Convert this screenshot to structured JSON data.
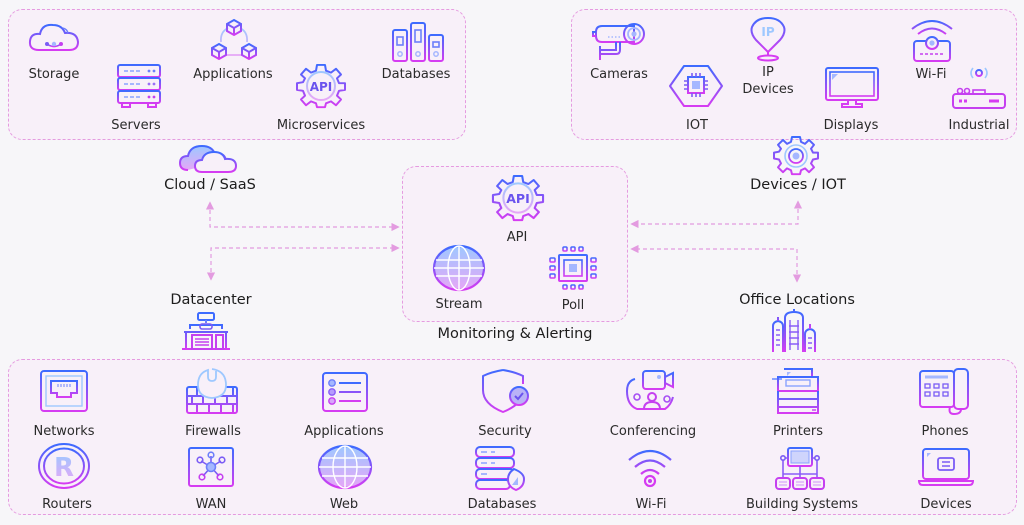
{
  "colors": {
    "gradient_top": "#3d6bff",
    "gradient_bottom": "#d63cf2",
    "accent_light": "#a5b7ff",
    "connector": "#e39be0",
    "box_border": "#e59be0",
    "box_fill": "#f8f0f9",
    "background": "#f7f6f9"
  },
  "cloud_group": {
    "items": [
      {
        "label": "Storage",
        "icon": "cloud-storage-icon"
      },
      {
        "label": "Servers",
        "icon": "server-rack-icon"
      },
      {
        "label": "Applications",
        "icon": "cubes-network-icon"
      },
      {
        "label": "Microservices",
        "icon": "api-gear-icon"
      },
      {
        "label": "Databases",
        "icon": "database-stack-icon"
      }
    ]
  },
  "devices_group": {
    "items": [
      {
        "label": "Cameras",
        "icon": "security-camera-icon"
      },
      {
        "label": "IOT",
        "icon": "chip-hexagon-icon"
      },
      {
        "label": "IP\nDevices",
        "label_line1": "IP",
        "label_line2": "Devices",
        "icon": "ip-pin-icon"
      },
      {
        "label": "Displays",
        "icon": "monitor-icon"
      },
      {
        "label": "Wi-Fi",
        "icon": "wifi-projector-icon"
      },
      {
        "label": "Industrial",
        "icon": "industrial-router-icon"
      }
    ]
  },
  "hubs": {
    "cloud": {
      "label": "Cloud / SaaS",
      "icon": "cloud-icon"
    },
    "devices": {
      "label": "Devices / IOT",
      "icon": "gear-eye-icon"
    },
    "datacenter": {
      "label": "Datacenter",
      "icon": "datacenter-building-icon"
    },
    "office": {
      "label": "Office Locations",
      "icon": "office-buildings-icon"
    }
  },
  "monitoring": {
    "title": "Monitoring & Alerting",
    "items": [
      {
        "label": "API",
        "icon": "api-gear-icon"
      },
      {
        "label": "Stream",
        "icon": "globe-icon"
      },
      {
        "label": "Poll",
        "icon": "chip-icon"
      }
    ]
  },
  "office_group": {
    "row1": [
      {
        "label": "Networks",
        "icon": "ethernet-port-icon"
      },
      {
        "label": "Firewalls",
        "icon": "firewall-icon"
      },
      {
        "label": "Applications",
        "icon": "app-list-icon"
      },
      {
        "label": "Security",
        "icon": "shield-check-icon"
      },
      {
        "label": "Conferencing",
        "icon": "video-conference-icon"
      },
      {
        "label": "Printers",
        "icon": "printer-icon"
      },
      {
        "label": "Phones",
        "icon": "desk-phone-icon"
      }
    ],
    "row2": [
      {
        "label": "Routers",
        "icon": "router-r-icon"
      },
      {
        "label": "WAN",
        "icon": "wan-nodes-icon"
      },
      {
        "label": "Web",
        "icon": "globe-icon"
      },
      {
        "label": "Databases",
        "icon": "database-shield-icon"
      },
      {
        "label": "Wi-Fi",
        "icon": "wifi-icon"
      },
      {
        "label": "Building Systems",
        "icon": "building-systems-icon"
      },
      {
        "label": "Devices",
        "icon": "laptop-icon"
      }
    ]
  }
}
